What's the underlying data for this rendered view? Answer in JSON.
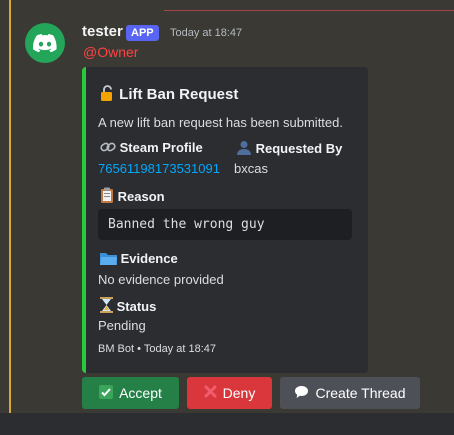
{
  "message": {
    "username": "tester",
    "badge": "APP",
    "timestamp": "Today at 18:47",
    "mention": "@Owner"
  },
  "embed": {
    "title": "Lift Ban Request",
    "title_icon": "unlock-icon",
    "description": "A new lift ban request has been submitted.",
    "fields": {
      "steam_profile": {
        "name": "Steam Profile",
        "icon": "link-icon",
        "value": "76561198173531091"
      },
      "requested_by": {
        "name": "Requested By",
        "icon": "user-icon",
        "value": "bxcas"
      },
      "reason": {
        "name": "Reason",
        "icon": "clipboard-icon",
        "value": "Banned the wrong guy"
      },
      "evidence": {
        "name": "Evidence",
        "icon": "folder-icon",
        "value": "No evidence provided"
      },
      "status": {
        "name": "Status",
        "icon": "hourglass-icon",
        "value": "Pending"
      }
    },
    "footer": "BM Bot • Today at 18:47",
    "accent_color": "#27c93f"
  },
  "buttons": {
    "accept": "Accept",
    "deny": "Deny",
    "create_thread": "Create Thread"
  },
  "colors": {
    "accept": "#248046",
    "deny": "#da373c",
    "secondary": "#4e5058",
    "mention": "#ff4242",
    "link": "#00a8fc"
  }
}
